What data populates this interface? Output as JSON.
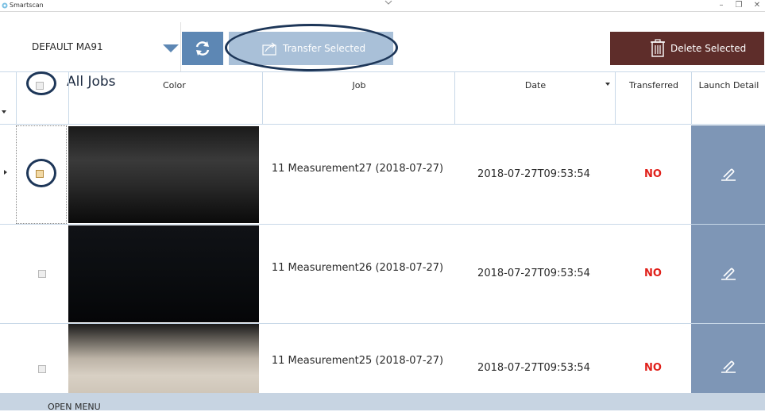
{
  "window": {
    "title": "Smartscan",
    "minimize_glyph": "–",
    "maximize_glyph": "❐",
    "close_glyph": "✕"
  },
  "toolbar": {
    "profile": "DEFAULT MA91",
    "transfer_label": "Transfer Selected",
    "delete_label": "Delete Selected"
  },
  "grid": {
    "all_jobs_label": "All Jobs",
    "columns": [
      "Color",
      "Job",
      "Date",
      "Transferred",
      "Launch Detail"
    ]
  },
  "rows": [
    {
      "checked": true,
      "job": "11 Measurement27 (2018-07-27)",
      "date": "2018-07-27T09:53:54",
      "transferred": "NO",
      "color_swatch": "dark-gray"
    },
    {
      "checked": false,
      "job": "11 Measurement26 (2018-07-27)",
      "date": "2018-07-27T09:53:54",
      "transferred": "NO",
      "color_swatch": "near-black"
    },
    {
      "checked": false,
      "job": "11 Measurement25 (2018-07-27)",
      "date": "2018-07-27T09:53:54",
      "transferred": "NO",
      "color_swatch": "beige"
    }
  ],
  "footer": {
    "open_menu": "OPEN MENU"
  },
  "colors": {
    "refresh_button": "#5d87b4",
    "transfer_button": "#a9c0d8",
    "delete_button": "#5e2d2a",
    "launch_cell": "#7e96b6",
    "status_no": "#e0201a",
    "status_bar": "#c7d4e2",
    "annotation_ring": "#1d3658"
  }
}
